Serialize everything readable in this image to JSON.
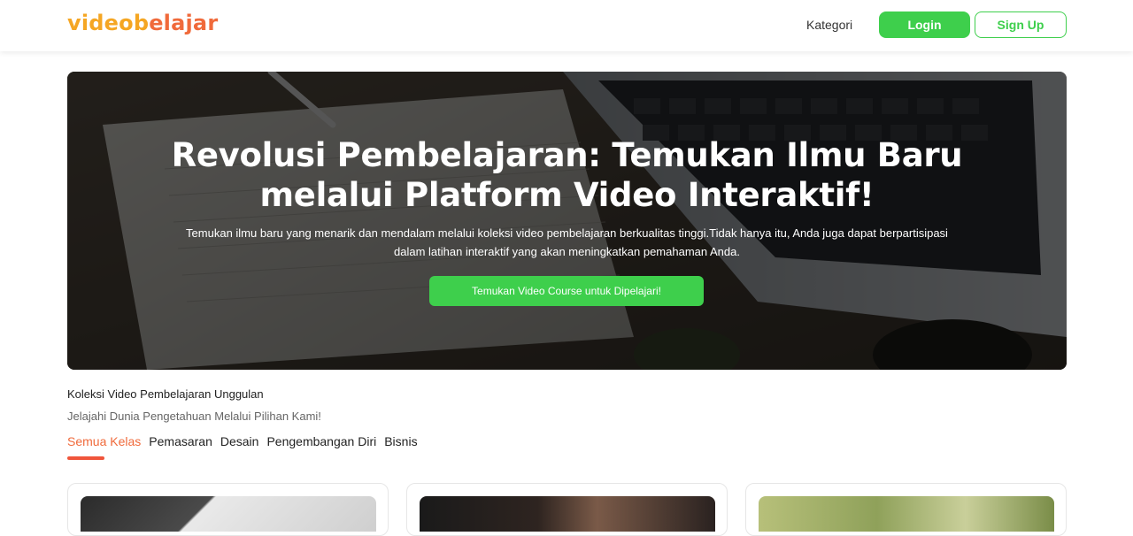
{
  "header": {
    "logo_part1": "videob",
    "logo_part2": "elajar",
    "nav_kategori": "Kategori",
    "login_label": "Login",
    "signup_label": "Sign Up"
  },
  "hero": {
    "title_line1": "Revolusi Pembelajaran: Temukan Ilmu Baru",
    "title_line2": "melalui Platform Video Interaktif!",
    "description_line1": "Temukan ilmu baru yang menarik dan mendalam melalui koleksi video pembelajaran berkualitas tinggi.Tidak hanya itu, Anda juga dapat berpartisipasi",
    "description_line2": "dalam latihan interaktif yang akan meningkatkan pemahaman Anda.",
    "cta_label": "Temukan Video Course untuk Dipelajari!"
  },
  "section": {
    "title": "Koleksi Video Pembelajaran Unggulan",
    "subtitle": "Jelajahi Dunia Pengetahuan Melalui Pilihan Kami!",
    "tabs": [
      {
        "label": "Semua Kelas",
        "active": true
      },
      {
        "label": "Pemasaran",
        "active": false
      },
      {
        "label": "Desain",
        "active": false
      },
      {
        "label": "Pengembangan Diri",
        "active": false
      },
      {
        "label": "Bisnis",
        "active": false
      }
    ]
  },
  "colors": {
    "primary_green": "#3ECF4C",
    "accent_orange": "#F06A3B",
    "logo_yellow": "#F5A623"
  }
}
